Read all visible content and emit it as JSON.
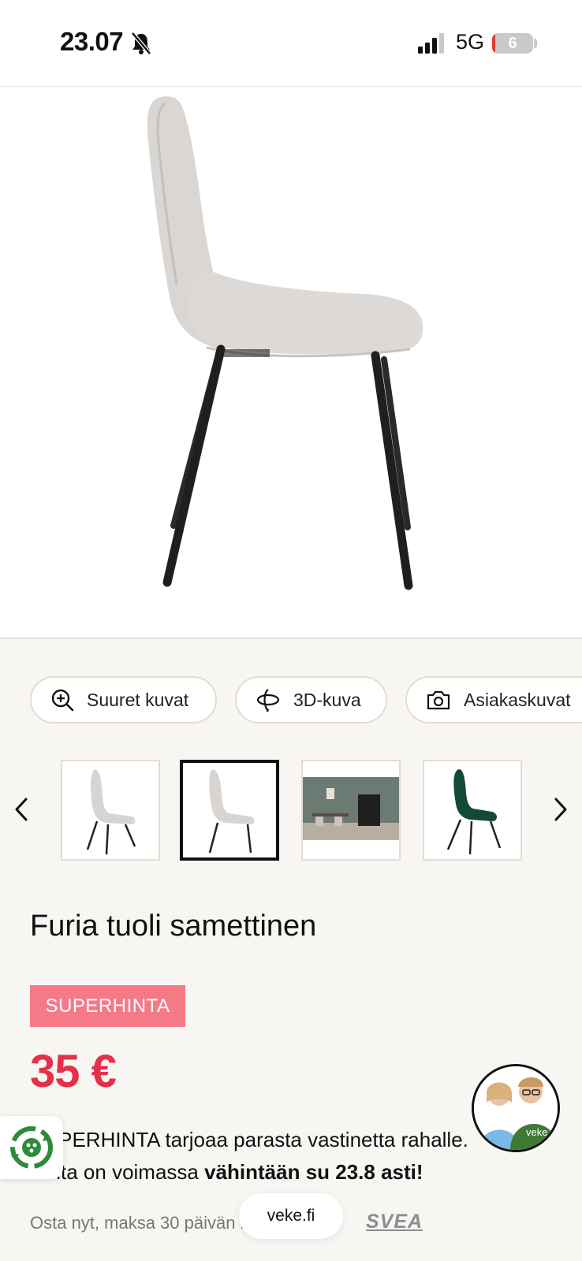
{
  "status_bar": {
    "time": "23.07",
    "network": "5G",
    "battery": "6",
    "icons": [
      "bell-muted-icon",
      "signal-icon",
      "battery-icon"
    ]
  },
  "gallery_actions": {
    "large_images": "Suuret kuvat",
    "view_3d": "3D-kuva",
    "customer_images": "Asiakaskuvat"
  },
  "thumbnails": {
    "count": 4,
    "selected_index": 1
  },
  "product": {
    "title": "Furia tuoli samettinen",
    "badge": "SUPERHINTA",
    "price": "35 €"
  },
  "promo": {
    "line1": "SUPERHINTA tarjoaa parasta vastinetta rahalle.",
    "line2_prefix": "Hinta on voimassa ",
    "line2_bold": "vähintään su 23.8 asti!"
  },
  "payment": {
    "text": "Osta nyt, maksa 30 päivän kuluttua.",
    "provider": "SVEA"
  },
  "browser": {
    "url": "veke.fi"
  },
  "chat": {
    "avatar_text": "veke"
  },
  "colors": {
    "price": "#e4304a",
    "badge": "#f47a88",
    "background": "#f8f6f3"
  }
}
